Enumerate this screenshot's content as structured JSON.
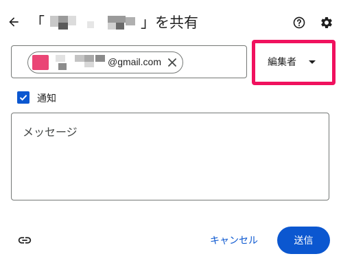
{
  "header": {
    "title_open": "「",
    "title_close": "」を共有",
    "back_icon": "arrow-left-icon",
    "help_icon": "help-circle-icon",
    "settings_icon": "gear-icon"
  },
  "recipient": {
    "email_suffix": "@gmail.com",
    "avatar_color": "#ea4575",
    "remove_icon": "close-icon"
  },
  "role": {
    "selected": "編集者",
    "highlight_color": "#f0115e"
  },
  "notify": {
    "label": "通知",
    "checked": true
  },
  "message": {
    "placeholder": "メッセージ",
    "value": ""
  },
  "footer": {
    "link_icon": "link-icon",
    "cancel_label": "キャンセル",
    "send_label": "送信"
  },
  "colors": {
    "accent": "#0b57d0"
  }
}
